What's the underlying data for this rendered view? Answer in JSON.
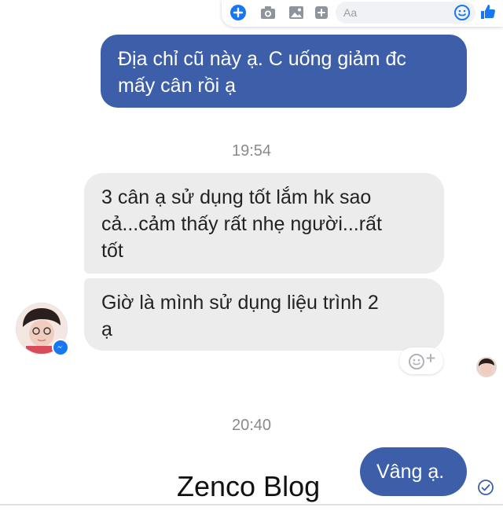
{
  "composer": {
    "placeholder": "Aa",
    "icons": [
      "plus-icon",
      "camera-icon",
      "image-icon",
      "sticker-icon",
      "emoji-icon",
      "like-icon"
    ],
    "accent": "#1877f2"
  },
  "messages": [
    {
      "id": "m1",
      "direction": "out",
      "lines": [
        "Địa chỉ cũ này ạ.  C uống giảm đc",
        "mấy cân rồi ạ"
      ]
    },
    {
      "id": "m2",
      "direction": "in",
      "lines": [
        "3 cân ạ sử dụng tốt lắm hk sao",
        "cả...cảm thấy rất nhẹ người...rất",
        "tốt"
      ]
    },
    {
      "id": "m3",
      "direction": "in",
      "lines": [
        "Giờ là mình sử dụng liệu trình 2",
        "ạ"
      ]
    },
    {
      "id": "m4",
      "direction": "out",
      "lines": [
        "Vâng ạ."
      ]
    }
  ],
  "timestamps": [
    "19:54",
    "20:40"
  ],
  "colors": {
    "outgoing_bubble": "#3d5ea8",
    "incoming_bubble": "#ececec",
    "timestamp": "#8a8a8a",
    "messenger_badge": "#1877f2"
  },
  "watermark": "Zenco Blog"
}
